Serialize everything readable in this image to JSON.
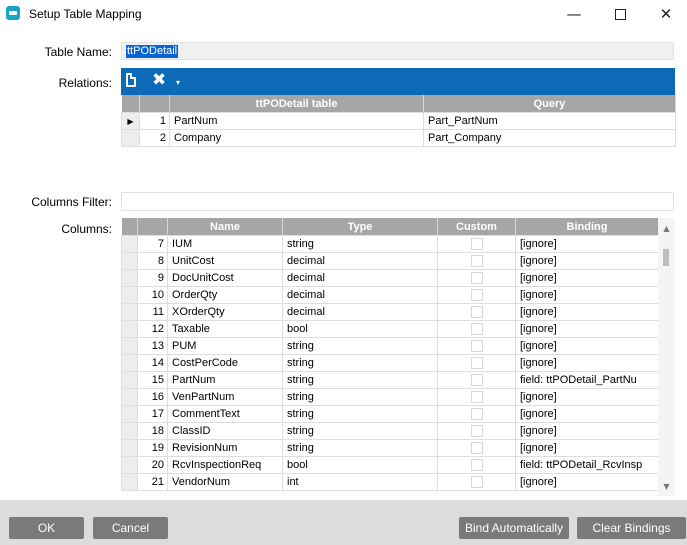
{
  "window": {
    "title": "Setup Table Mapping",
    "minimize_glyph": "—",
    "close_glyph": "✕"
  },
  "table_name": {
    "label": "Table Name:",
    "value": "ttPODetail"
  },
  "relations": {
    "label": "Relations:",
    "toolbar": {
      "x_glyph": "✖",
      "caret_glyph": "▾"
    },
    "headers": [
      "ttPODetail table",
      "Query"
    ],
    "current_row_glyph": "▶",
    "rows": [
      {
        "num": "1",
        "field": "PartNum",
        "query": "Part_PartNum"
      },
      {
        "num": "2",
        "field": "Company",
        "query": "Part_Company"
      }
    ]
  },
  "columns_filter": {
    "label": "Columns Filter:",
    "value": ""
  },
  "columns": {
    "label": "Columns:",
    "headers": [
      "Name",
      "Type",
      "Custom",
      "Binding"
    ],
    "rows": [
      {
        "num": "7",
        "name": "IUM",
        "type": "string",
        "binding": "[ignore]"
      },
      {
        "num": "8",
        "name": "UnitCost",
        "type": "decimal",
        "binding": "[ignore]"
      },
      {
        "num": "9",
        "name": "DocUnitCost",
        "type": "decimal",
        "binding": "[ignore]"
      },
      {
        "num": "10",
        "name": "OrderQty",
        "type": "decimal",
        "binding": "[ignore]"
      },
      {
        "num": "11",
        "name": "XOrderQty",
        "type": "decimal",
        "binding": "[ignore]"
      },
      {
        "num": "12",
        "name": "Taxable",
        "type": "bool",
        "binding": "[ignore]"
      },
      {
        "num": "13",
        "name": "PUM",
        "type": "string",
        "binding": "[ignore]"
      },
      {
        "num": "14",
        "name": "CostPerCode",
        "type": "string",
        "binding": "[ignore]"
      },
      {
        "num": "15",
        "name": "PartNum",
        "type": "string",
        "binding": "field: ttPODetail_PartNu"
      },
      {
        "num": "16",
        "name": "VenPartNum",
        "type": "string",
        "binding": "[ignore]"
      },
      {
        "num": "17",
        "name": "CommentText",
        "type": "string",
        "binding": "[ignore]"
      },
      {
        "num": "18",
        "name": "ClassID",
        "type": "string",
        "binding": "[ignore]"
      },
      {
        "num": "19",
        "name": "RevisionNum",
        "type": "string",
        "binding": "[ignore]"
      },
      {
        "num": "20",
        "name": "RcvInspectionReq",
        "type": "bool",
        "binding": "field: ttPODetail_RcvInsp"
      },
      {
        "num": "21",
        "name": "VendorNum",
        "type": "int",
        "binding": "[ignore]"
      }
    ],
    "scroll_up_glyph": "▲",
    "scroll_down_glyph": "▼"
  },
  "footer": {
    "ok": "OK",
    "cancel": "Cancel",
    "bind_automatically": "Bind Automatically",
    "clear_bindings": "Clear Bindings"
  },
  "colors": {
    "toolbar_blue": "#0c6ab8",
    "header_gray": "#a6a6a6",
    "button_gray": "#7a7a7a",
    "selection_blue": "#0a64d8"
  }
}
